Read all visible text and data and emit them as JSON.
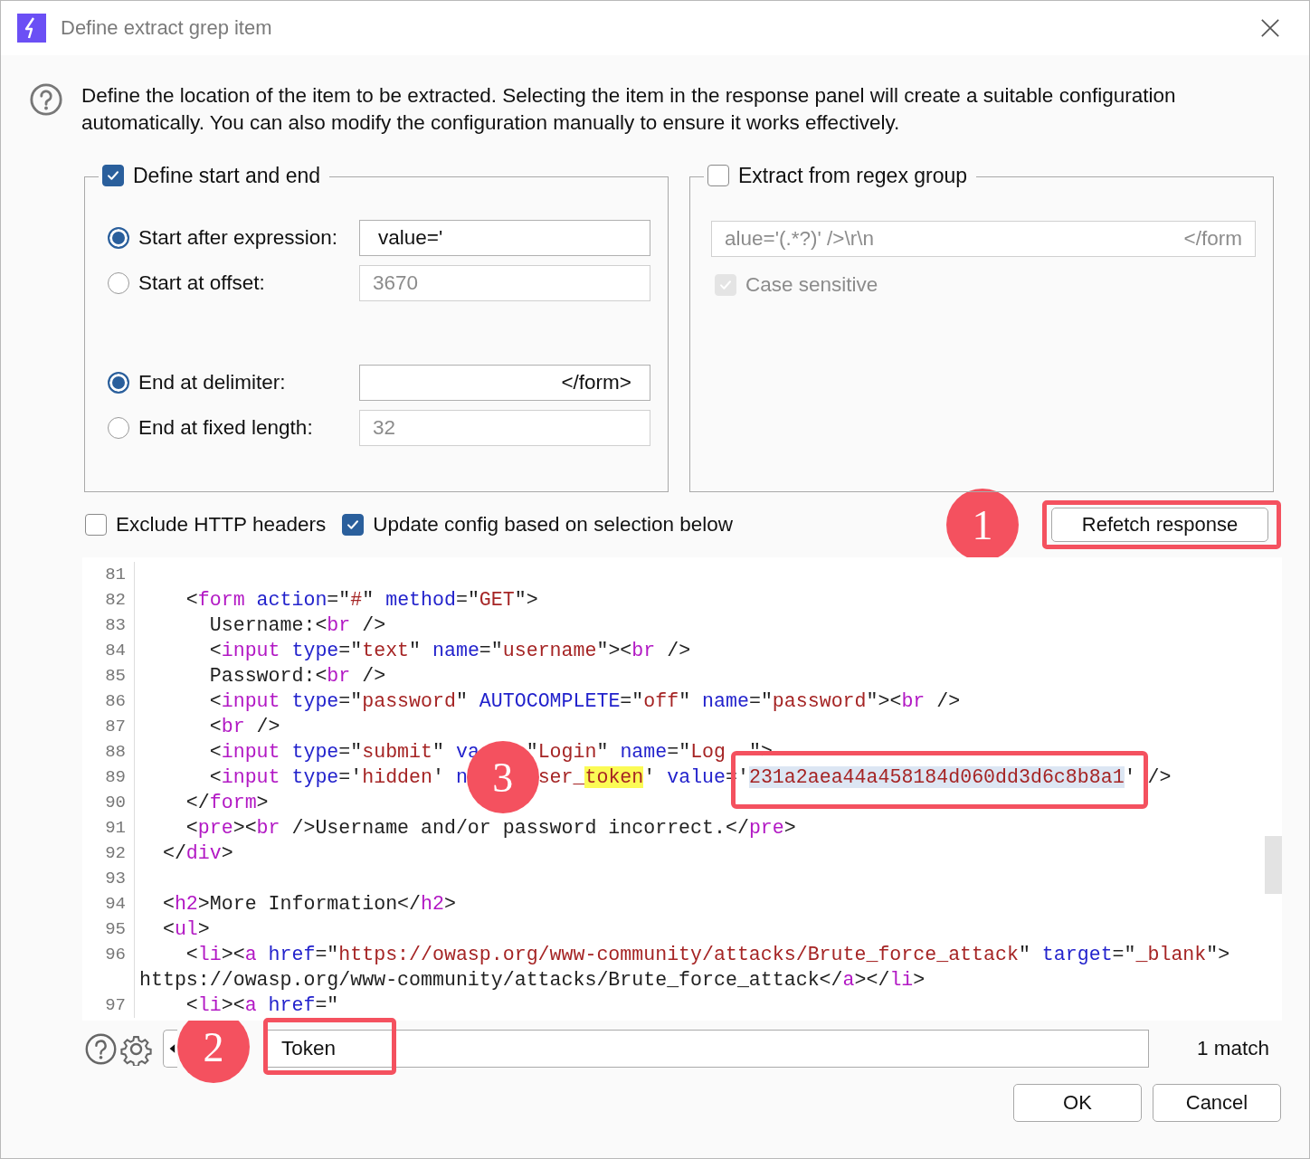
{
  "window": {
    "title": "Define extract grep item"
  },
  "description": "Define the location of the item to be extracted. Selecting the item in the response panel will create a suitable configuration automatically. You can also modify the configuration manually to ensure it works effectively.",
  "start_end": {
    "label": "Define start and end",
    "checked": true,
    "start": [
      {
        "label": "Start after expression:",
        "selected": true,
        "value": "value='"
      },
      {
        "label": "Start at offset:",
        "selected": false,
        "value": "3670"
      }
    ],
    "end": [
      {
        "label": "End at delimiter:",
        "selected": true,
        "value": "</form>"
      },
      {
        "label": "End at fixed length:",
        "selected": false,
        "value": "32"
      }
    ]
  },
  "regex": {
    "label": "Extract from regex group",
    "checked": false,
    "value_left": "alue='(.*?)' />\\r\\n",
    "value_right": "</form",
    "case_sensitive": {
      "label": "Case sensitive",
      "checked": true
    }
  },
  "options": [
    {
      "label": "Exclude HTTP headers",
      "checked": false
    },
    {
      "label": "Update config based on selection below",
      "checked": true
    }
  ],
  "refetch": {
    "label": "Refetch response",
    "marker": "1",
    "framed": true
  },
  "code": {
    "marker": "3",
    "framed": true,
    "lines": [
      {
        "n": "81"
      },
      {
        "n": "82",
        "tokens": [
          {
            "kind": "plain",
            "text": "    <"
          },
          {
            "kind": "tag",
            "text": "form"
          },
          {
            "kind": "attr",
            "text": " action"
          },
          {
            "kind": "plain",
            "text": "=\""
          },
          {
            "kind": "string",
            "text": "#"
          },
          {
            "kind": "plain",
            "text": "\""
          },
          {
            "kind": "attr",
            "text": " method"
          },
          {
            "kind": "plain",
            "text": "=\""
          },
          {
            "kind": "string",
            "text": "GET"
          },
          {
            "kind": "plain",
            "text": "\">"
          }
        ]
      },
      {
        "n": "83",
        "tokens": [
          {
            "kind": "plain",
            "text": "      Username:<"
          },
          {
            "kind": "tag",
            "text": "br"
          },
          {
            "kind": "plain",
            "text": " />"
          }
        ]
      },
      {
        "n": "84",
        "tokens": [
          {
            "kind": "plain",
            "text": "      <"
          },
          {
            "kind": "tag",
            "text": "input"
          },
          {
            "kind": "attr",
            "text": " type"
          },
          {
            "kind": "plain",
            "text": "=\""
          },
          {
            "kind": "string",
            "text": "text"
          },
          {
            "kind": "plain",
            "text": "\""
          },
          {
            "kind": "attr",
            "text": " name"
          },
          {
            "kind": "plain",
            "text": "=\""
          },
          {
            "kind": "string",
            "text": "username"
          },
          {
            "kind": "plain",
            "text": "\"><"
          },
          {
            "kind": "tag",
            "text": "br"
          },
          {
            "kind": "plain",
            "text": " />"
          }
        ]
      },
      {
        "n": "85",
        "tokens": [
          {
            "kind": "plain",
            "text": "      Password:<"
          },
          {
            "kind": "tag",
            "text": "br"
          },
          {
            "kind": "plain",
            "text": " />"
          }
        ]
      },
      {
        "n": "86",
        "tokens": [
          {
            "kind": "plain",
            "text": "      <"
          },
          {
            "kind": "tag",
            "text": "input"
          },
          {
            "kind": "attr",
            "text": " type"
          },
          {
            "kind": "plain",
            "text": "=\""
          },
          {
            "kind": "string",
            "text": "password"
          },
          {
            "kind": "plain",
            "text": "\""
          },
          {
            "kind": "attr",
            "text": " AUTOCOMPLETE"
          },
          {
            "kind": "plain",
            "text": "=\""
          },
          {
            "kind": "string",
            "text": "off"
          },
          {
            "kind": "plain",
            "text": "\""
          },
          {
            "kind": "attr",
            "text": " name"
          },
          {
            "kind": "plain",
            "text": "=\""
          },
          {
            "kind": "string",
            "text": "password"
          },
          {
            "kind": "plain",
            "text": "\"><"
          },
          {
            "kind": "tag",
            "text": "br"
          },
          {
            "kind": "plain",
            "text": " />"
          }
        ]
      },
      {
        "n": "87",
        "tokens": [
          {
            "kind": "plain",
            "text": "      <"
          },
          {
            "kind": "tag",
            "text": "br"
          },
          {
            "kind": "plain",
            "text": " />"
          }
        ]
      },
      {
        "n": "88",
        "tokens": [
          {
            "kind": "plain",
            "text": "      <"
          },
          {
            "kind": "tag",
            "text": "input"
          },
          {
            "kind": "attr",
            "text": " type"
          },
          {
            "kind": "plain",
            "text": "=\""
          },
          {
            "kind": "string",
            "text": "submit"
          },
          {
            "kind": "plain",
            "text": "\""
          },
          {
            "kind": "attr",
            "text": " va"
          },
          {
            "kind": "gap4"
          },
          {
            "kind": "plain",
            "text": "\""
          },
          {
            "kind": "string",
            "text": "Login"
          },
          {
            "kind": "plain",
            "text": "\""
          },
          {
            "kind": "attr",
            "text": " name"
          },
          {
            "kind": "plain",
            "text": "=\""
          },
          {
            "kind": "string",
            "text": "Log"
          },
          {
            "kind": "gap2"
          },
          {
            "kind": "plain",
            "text": "\">"
          }
        ]
      },
      {
        "n": "89",
        "tokens": [
          {
            "kind": "plain",
            "text": "      <"
          },
          {
            "kind": "tag",
            "text": "input"
          },
          {
            "kind": "attr",
            "text": " type"
          },
          {
            "kind": "plain",
            "text": "='"
          },
          {
            "kind": "string",
            "text": "hidden"
          },
          {
            "kind": "plain",
            "text": "'"
          },
          {
            "kind": "attr",
            "text": " n"
          },
          {
            "kind": "gap6"
          },
          {
            "kind": "string",
            "text": "ser_"
          },
          {
            "kind": "highlight",
            "text": "token"
          },
          {
            "kind": "plain",
            "text": "'"
          },
          {
            "kind": "attr",
            "text": " value"
          },
          {
            "kind": "plain",
            "text": "='"
          },
          {
            "kind": "selection",
            "text": "231a2aea44a458184d060dd3d6c8b8a1"
          },
          {
            "kind": "plain",
            "text": "' />"
          }
        ]
      },
      {
        "n": "90",
        "tokens": [
          {
            "kind": "plain",
            "text": "    </"
          },
          {
            "kind": "tag",
            "text": "form"
          },
          {
            "kind": "plain",
            "text": ">"
          }
        ]
      },
      {
        "n": "91",
        "tokens": [
          {
            "kind": "plain",
            "text": "    <"
          },
          {
            "kind": "tag",
            "text": "pre"
          },
          {
            "kind": "plain",
            "text": "><"
          },
          {
            "kind": "tag",
            "text": "br"
          },
          {
            "kind": "plain",
            "text": " />Username and/or password incorrect.</"
          },
          {
            "kind": "tag",
            "text": "pre"
          },
          {
            "kind": "plain",
            "text": ">"
          }
        ]
      },
      {
        "n": "92",
        "tokens": [
          {
            "kind": "plain",
            "text": "  </"
          },
          {
            "kind": "tag",
            "text": "div"
          },
          {
            "kind": "plain",
            "text": ">"
          }
        ]
      },
      {
        "n": "93"
      },
      {
        "n": "94",
        "tokens": [
          {
            "kind": "plain",
            "text": "  <"
          },
          {
            "kind": "tag",
            "text": "h2"
          },
          {
            "kind": "plain",
            "text": ">More Information</"
          },
          {
            "kind": "tag",
            "text": "h2"
          },
          {
            "kind": "plain",
            "text": ">"
          }
        ]
      },
      {
        "n": "95",
        "tokens": [
          {
            "kind": "plain",
            "text": "  <"
          },
          {
            "kind": "tag",
            "text": "ul"
          },
          {
            "kind": "plain",
            "text": ">"
          }
        ]
      },
      {
        "n": "96",
        "tokens": [
          {
            "kind": "plain",
            "text": "    <"
          },
          {
            "kind": "tag",
            "text": "li"
          },
          {
            "kind": "plain",
            "text": "><"
          },
          {
            "kind": "tag",
            "text": "a"
          },
          {
            "kind": "attr",
            "text": " href"
          },
          {
            "kind": "plain",
            "text": "=\""
          },
          {
            "kind": "string",
            "text": "https://owasp.org/www-community/attacks/Brute_force_attack"
          },
          {
            "kind": "plain",
            "text": "\""
          },
          {
            "kind": "attr",
            "text": " target"
          },
          {
            "kind": "plain",
            "text": "=\""
          },
          {
            "kind": "string",
            "text": "_blank"
          },
          {
            "kind": "plain",
            "text": "\">"
          }
        ],
        "cont": [
          {
            "kind": "plain",
            "text": "https://owasp.org/www-community/attacks/Brute_force_attack</"
          },
          {
            "kind": "tag",
            "text": "a"
          },
          {
            "kind": "plain",
            "text": "></"
          },
          {
            "kind": "tag",
            "text": "li"
          },
          {
            "kind": "plain",
            "text": ">"
          }
        ]
      },
      {
        "n": "97",
        "tokens": [
          {
            "kind": "plain",
            "text": "    <"
          },
          {
            "kind": "tag",
            "text": "li"
          },
          {
            "kind": "plain",
            "text": "><"
          },
          {
            "kind": "tag",
            "text": "a"
          },
          {
            "kind": "attr",
            "text": " href"
          },
          {
            "kind": "plain",
            "text": "=\""
          }
        ]
      }
    ]
  },
  "search": {
    "marker": "2",
    "framed": true,
    "value": "Token",
    "matches": "1 match"
  },
  "buttons": [
    "OK",
    "Cancel"
  ]
}
